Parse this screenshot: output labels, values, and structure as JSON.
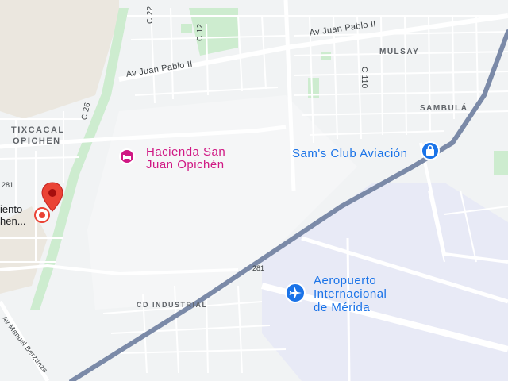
{
  "map": {
    "areas": {
      "tixcacal_opichen": [
        "TIXCACAL",
        "OPICHEN"
      ],
      "mulsay": "MULSAY",
      "sambula": "SAMBULÁ",
      "cd_industrial": "CD INDUSTRIAL"
    },
    "streets": {
      "av_juan_pablo_ii_east": "Av Juan Pablo II",
      "av_juan_pablo_ii_west": "Av Juan Pablo II",
      "c22": "C 22",
      "c12": "C 12",
      "c26": "C 26",
      "c110": "C 110",
      "manuel_berzunza": "Av Manuel Berzunza",
      "route_281_west": "281",
      "route_281_east": "281"
    },
    "pois": {
      "hacienda": {
        "lines": [
          "Hacienda San",
          "Juan Opichén"
        ],
        "color": "#d01884",
        "icon": "hotel-icon"
      },
      "sams_club": {
        "label": "Sam's Club Aviación",
        "color": "#1a73e8",
        "icon": "shopping-bag-icon"
      },
      "airport": {
        "lines": [
          "Aeropuerto",
          "Internacional",
          "de Mérida"
        ],
        "color": "#1a73e8",
        "icon": "airplane-icon"
      },
      "selected_place": {
        "lines": [
          "iento",
          "hen..."
        ],
        "pin_color": "#ea4335",
        "icon": "map-pin-icon"
      }
    },
    "colors": {
      "land": "#f1f3f4",
      "park": "#cdeccf",
      "highway": "#7b8aa8",
      "airport_area": "#e8eaf6"
    }
  }
}
